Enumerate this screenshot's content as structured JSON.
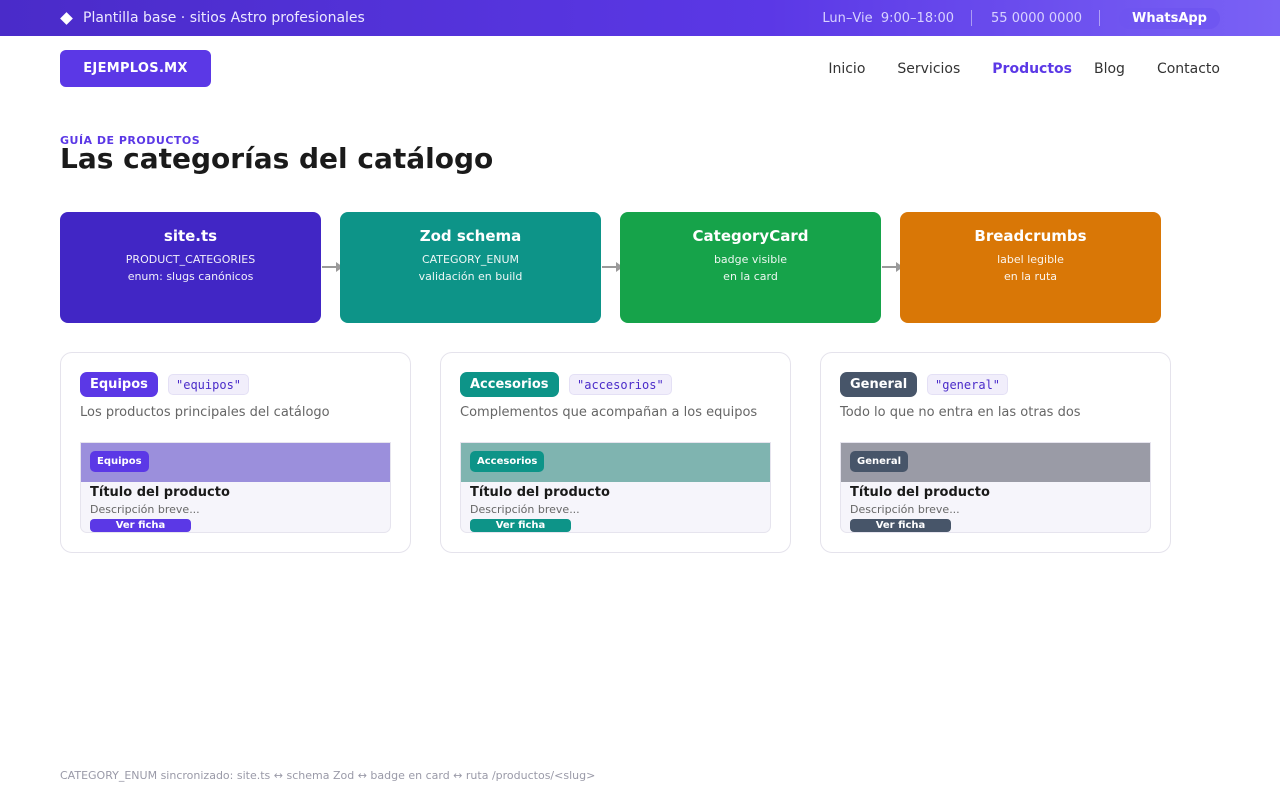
{
  "topbar": {
    "tagline": "Plantilla base · sitios Astro profesionales",
    "hours": "Lun–Vie  9:00–18:00",
    "phone": "55 0000 0000",
    "whatsapp_label": "WhatsApp"
  },
  "header": {
    "logo_text": "EJEMPLOS.MX",
    "nav": [
      {
        "label": "Inicio",
        "active": false
      },
      {
        "label": "Servicios",
        "active": false
      },
      {
        "label": "Productos",
        "active": true
      },
      {
        "label": "Blog",
        "active": false
      },
      {
        "label": "Contacto",
        "active": false
      }
    ]
  },
  "main": {
    "eyebrow": "GUÍA DE PRODUCTOS",
    "title": "Las categorías del catálogo"
  },
  "flow": [
    {
      "title": "site.ts",
      "line1": "PRODUCT_CATEGORIES",
      "line2": "enum: slugs canónicos",
      "color": "#4126c5"
    },
    {
      "title": "Zod schema",
      "line1": "CATEGORY_ENUM",
      "line2": "validación en build",
      "color": "#0d9488"
    },
    {
      "title": "CategoryCard",
      "line1": "badge visible",
      "line2": "en la card",
      "color": "#16a34a"
    },
    {
      "title": "Breadcrumbs",
      "line1": "label legible",
      "line2": "en la ruta",
      "color": "#d97706"
    }
  ],
  "categories": [
    {
      "label": "Equipos",
      "slug": "\"equipos\"",
      "description": "Los productos principales del catálogo",
      "color": "#5b38e6",
      "band_color": "#9b8fdc",
      "preview_title": "Título del producto",
      "preview_desc": "Descripción breve...",
      "preview_button": "Ver ficha"
    },
    {
      "label": "Accesorios",
      "slug": "\"accesorios\"",
      "description": "Complementos que acompañan a los equipos",
      "color": "#0d9488",
      "band_color": "#7fb4b0",
      "preview_title": "Título del producto",
      "preview_desc": "Descripción breve...",
      "preview_button": "Ver ficha"
    },
    {
      "label": "General",
      "slug": "\"general\"",
      "description": "Todo lo que no entra en las otras dos",
      "color": "#475569",
      "band_color": "#9a9ba6",
      "preview_title": "Título del producto",
      "preview_desc": "Descripción breve...",
      "preview_button": "Ver ficha"
    }
  ],
  "footer": {
    "note": "CATEGORY_ENUM sincronizado: site.ts ↔ schema Zod ↔ badge en card ↔ ruta /productos/<slug>"
  }
}
